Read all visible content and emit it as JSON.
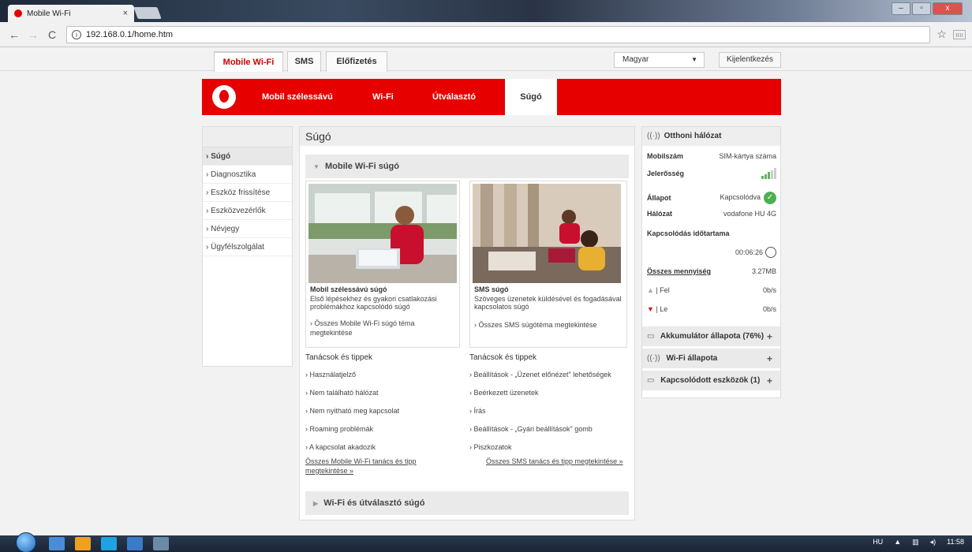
{
  "browser": {
    "tab_title": "Mobile Wi-Fi",
    "tab_close": "×",
    "url": "192.168.0.1/home.htm",
    "win_min": "‒",
    "win_max": "▫",
    "win_close": "x"
  },
  "topnav": {
    "tabs": [
      "Mobile Wi-Fi",
      "SMS",
      "Előfizetés"
    ],
    "language": "Magyar",
    "logout": "Kijelentkezés"
  },
  "mainnav": {
    "items": [
      "Mobil szélessávú",
      "Wi-Fi",
      "Útválasztó",
      "Súgó"
    ]
  },
  "sidebar": {
    "items": [
      "› Súgó",
      "› Diagnosztika",
      "› Eszköz frissítése",
      "› Eszközvezérlők",
      "› Névjegy",
      "› Ügyfélszolgálat"
    ]
  },
  "main": {
    "title": "Súgó",
    "section1": "Mobile Wi-Fi súgó",
    "card1": {
      "title": "Mobil szélessávú súgó",
      "desc": "Első lépésekhez és gyakori csatlakozási problémákhoz kapcsolódó súgó",
      "link": "› Összes Mobile Wi-Fi súgó téma megtekintése"
    },
    "card2": {
      "title": "SMS súgó",
      "desc": "Szöveges üzenetek küldésével és fogadásával kapcsolatos súgó",
      "link": "› Összes SMS súgótéma megtekintése"
    },
    "tips_title_left": "Tanácsok és tippek",
    "tips_title_right": "Tanácsok és tippek",
    "tips_left": [
      "› Használatjelző",
      "› Nem található hálózat",
      "› Nem nyitható meg kapcsolat",
      "› Roaming problémák",
      "› A kapcsolat akadozik"
    ],
    "tips_right": [
      "› Beállítások - „Üzenet előnézet\" lehetőségek",
      "› Beérkezett üzenetek",
      "› Írás",
      "› Beállítások - „Gyári beállítások\" gomb",
      "› Piszkozatok"
    ],
    "all_left": "Összes Mobile Wi-Fi tanács és tipp megtekintése »",
    "all_right": "Összes SMS tanács és tipp megtekintése »",
    "section2": "Wi-Fi és útválasztó súgó"
  },
  "rpanel": {
    "title": "Otthoni hálózat",
    "mobile_label": "Mobilszám",
    "mobile_value": "SIM-kártya száma",
    "signal_label": "Jelerősség",
    "signal_level": 0.6,
    "state_label": "Állapot",
    "state_value": "Kapcsolódva",
    "network_label": "Hálózat",
    "network_value": "vodafone HU 4G",
    "duration_label": "Kapcsolódás időtartama",
    "duration_value": "00:06:26",
    "total_label": "Összes mennyiség",
    "total_value": "3.27MB",
    "up_label": "| Fel",
    "up_value": "0b/s",
    "down_label": "| Le",
    "down_value": "0b/s",
    "battery": "Akkumulátor állapota (76%)",
    "wifi": "Wi-Fi állapota",
    "devices": "Kapcsolódott eszközök (1)",
    "plus": "+"
  },
  "taskbar": {
    "lang": "HU",
    "time": "11:58"
  },
  "colors": {
    "brand_red": "#e60000",
    "status_green": "#4caf50"
  }
}
